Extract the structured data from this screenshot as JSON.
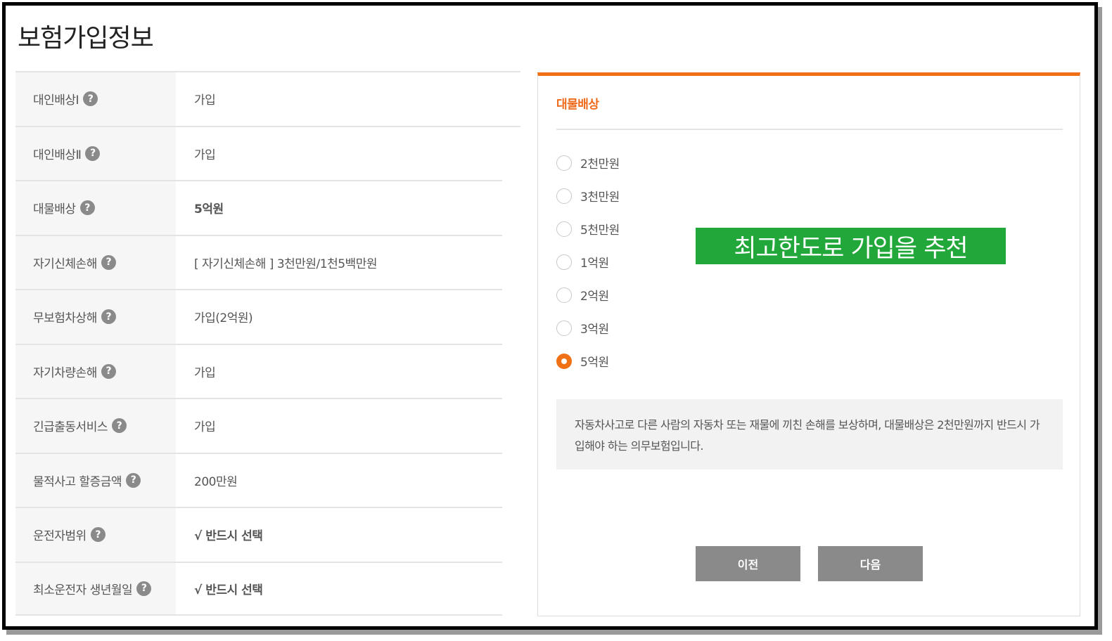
{
  "page": {
    "title": "보험가입정보"
  },
  "info_rows": [
    {
      "label": "대인배상Ⅰ",
      "value": "가입"
    },
    {
      "label": "대인배상Ⅱ",
      "value": "가입"
    },
    {
      "label": "대물배상",
      "value": "5억원"
    },
    {
      "label": "자기신체손해",
      "value": "[ 자기신체손해 ]  3천만원/1천5백만원"
    },
    {
      "label": "무보험차상해",
      "value": "가입(2억원)"
    },
    {
      "label": "자기차량손해",
      "value": "가입"
    },
    {
      "label": "긴급출동서비스",
      "value": "가입"
    },
    {
      "label": "물적사고 할증금액",
      "value": "200만원"
    },
    {
      "label": "운전자범위",
      "value": "√ 반드시 선택"
    },
    {
      "label": "최소운전자 생년월일",
      "value": "√ 반드시 선택"
    }
  ],
  "help_icon_glyph": "?",
  "panel": {
    "title": "대물배상",
    "options": [
      "2천만원",
      "3천만원",
      "5천만원",
      "1억원",
      "2억원",
      "3억원",
      "5억원"
    ],
    "selected": "5억원",
    "recommendation": "최고한도로 가입을 추천",
    "description": "자동차사고로 다른 사람의 자동차 또는 재물에 끼친 손해를 보상하며, 대물배상은 2천만원까지 반드시 가입해야 하는 의무보험입니다.",
    "prev_label": "이전",
    "next_label": "다음"
  },
  "colors": {
    "accent": "#f07015",
    "recommend": "#22a83a",
    "button": "#8a8a8a"
  }
}
